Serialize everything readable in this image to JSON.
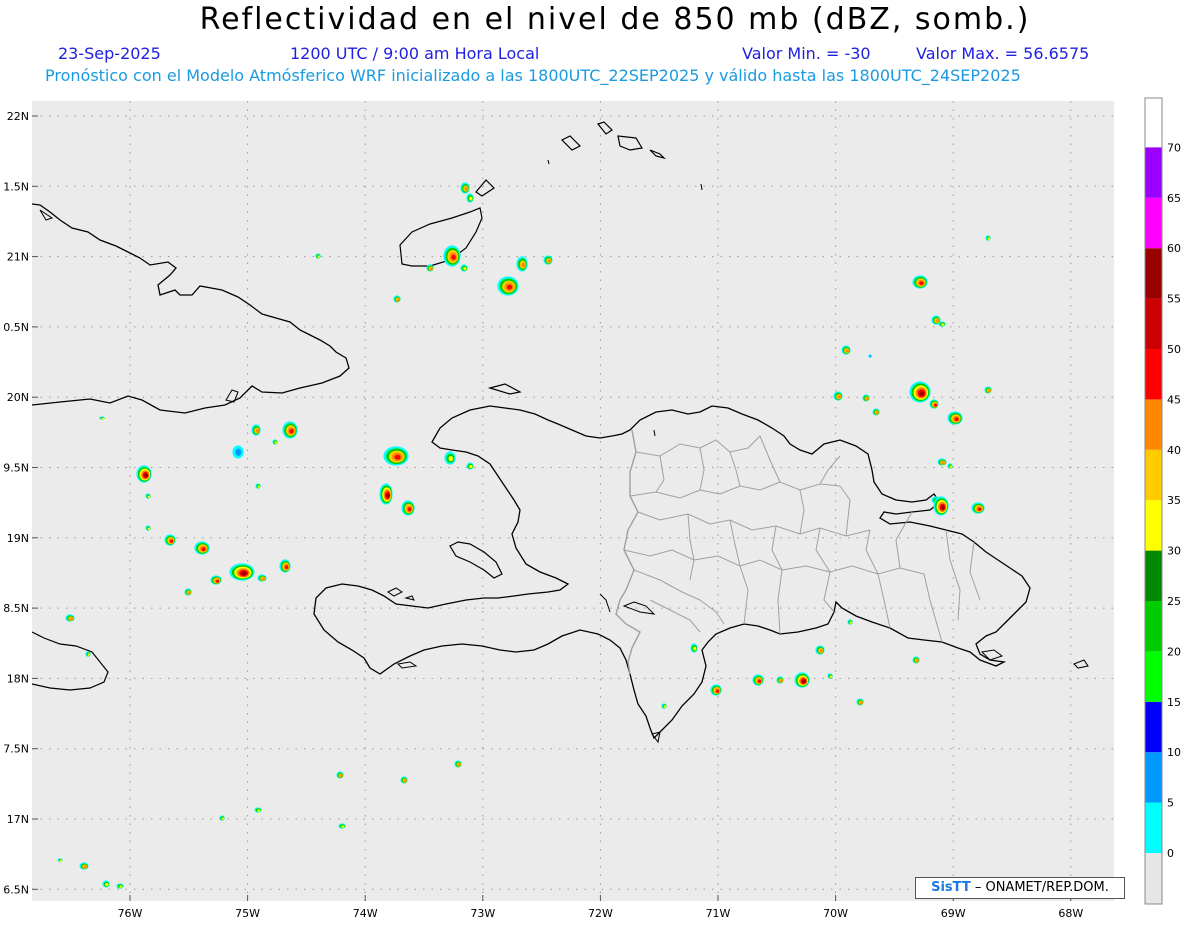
{
  "title": "Reflectividad en el nivel de 850 mb (dBZ, somb.)",
  "date": "23-Sep-2025",
  "time": "1200 UTC / 9:00 am Hora Local",
  "min_label": "Valor Min. = -30",
  "max_label": "Valor Max. = 56.6575",
  "forecast": "Pronóstico con el Modelo Atmósferico WRF inicializado a las 1800UTC_22SEP2025 y válido hasta las  1800UTC_24SEP2025",
  "lat_labels": [
    "22N",
    "1.5N",
    "21N",
    "0.5N",
    "20N",
    "9.5N",
    "19N",
    "8.5N",
    "18N",
    "7.5N",
    "17N",
    "6.5N"
  ],
  "lon_labels": [
    "76W",
    "75W",
    "74W",
    "73W",
    "72W",
    "71W",
    "70W",
    "69W",
    "68W"
  ],
  "colorbar": {
    "ticks": [
      "0",
      "5",
      "10",
      "15",
      "20",
      "25",
      "30",
      "35",
      "40",
      "45",
      "50",
      "55",
      "60",
      "65",
      "70"
    ],
    "colors": [
      "#00ffff",
      "#0099ff",
      "#0000ff",
      "#00ff00",
      "#00cc00",
      "#008800",
      "#ffff00",
      "#ffcc00",
      "#ff8800",
      "#ff0000",
      "#cc0000",
      "#990000",
      "#ff00ff",
      "#9900ff"
    ]
  },
  "credit": {
    "logo": "SisTT",
    "text": "– ONAMET/REP.DOM."
  },
  "colors": {
    "map_bg": "#ebebeb",
    "coast": "#000000",
    "borders": "#a0a0a0",
    "header_blue": "#2020e0",
    "header_cyan": "#1a9ae0"
  }
}
